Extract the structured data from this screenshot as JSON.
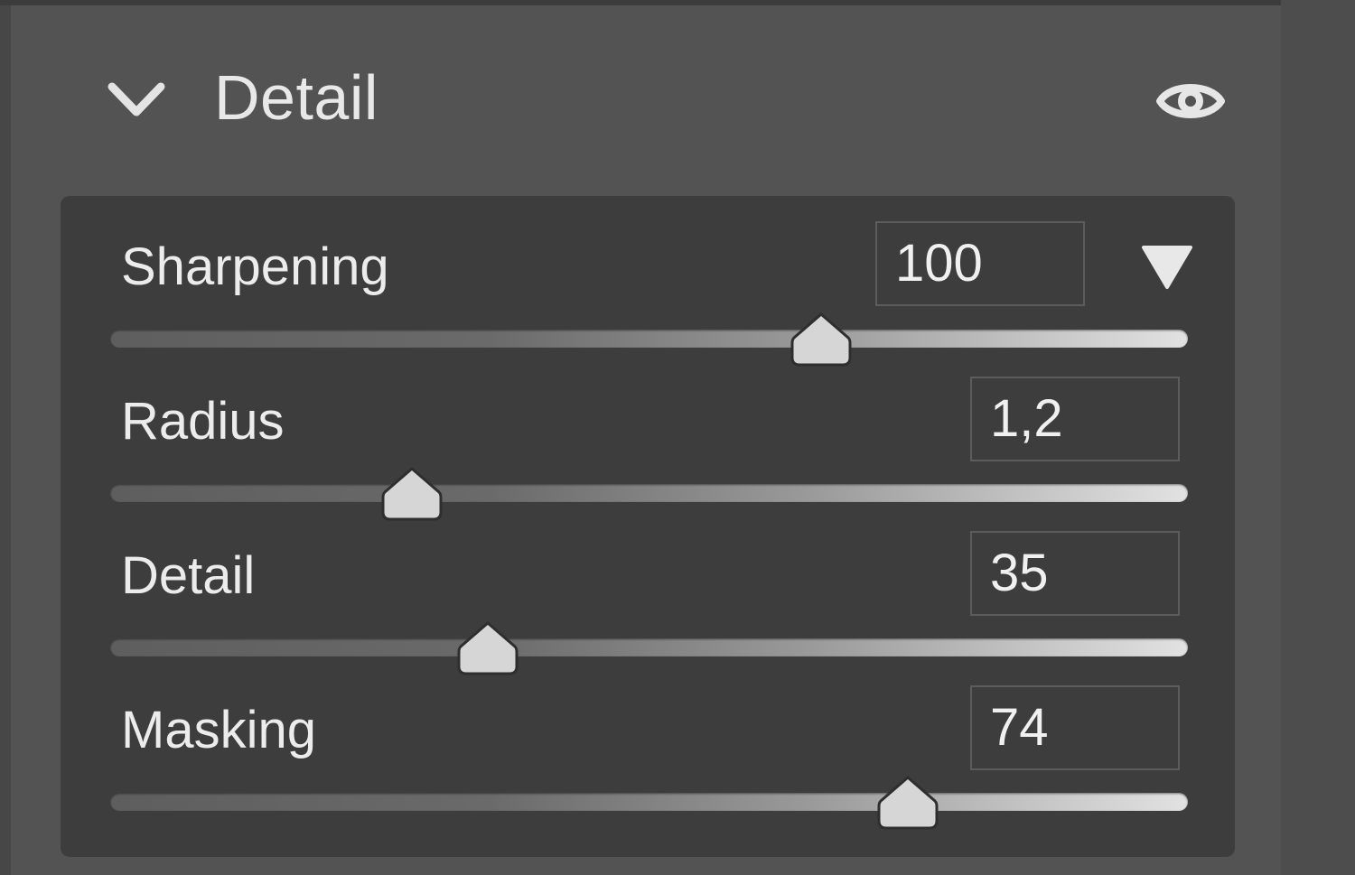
{
  "section": {
    "title": "Detail",
    "icons": {
      "collapse": "chevron-down-icon",
      "visibility": "eye-icon"
    }
  },
  "sliders": [
    {
      "label": "Sharpening",
      "value": "100",
      "level": 0.66,
      "has_dropdown": true
    },
    {
      "label": "Radius",
      "value": "1,2",
      "level": 0.28
    },
    {
      "label": "Detail",
      "value": "35",
      "level": 0.35
    },
    {
      "label": "Masking",
      "value": "74",
      "level": 0.74
    }
  ],
  "dropdown": {
    "icon": "triangle-down-icon"
  },
  "colors": {
    "panel_bg": "#535353",
    "content_bg": "#3d3d3d",
    "text": "#ececec",
    "thumb": "#d6d6d6"
  }
}
